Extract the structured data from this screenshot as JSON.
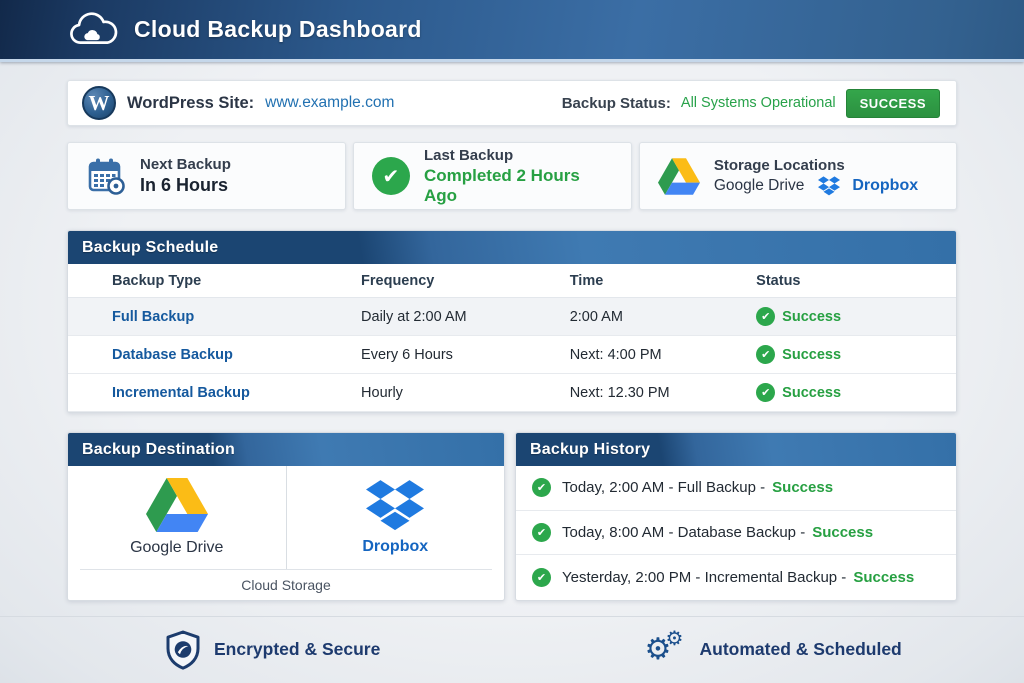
{
  "header": {
    "title": "Cloud Backup Dashboard"
  },
  "site_bar": {
    "label": "WordPress Site:",
    "url": "www.example.com",
    "status_label": "Backup Status:",
    "status_value": "All Systems Operational",
    "badge": "SUCCESS",
    "wp_initial": "W"
  },
  "cards": {
    "next": {
      "title": "Next Backup",
      "value": "In 6 Hours"
    },
    "last": {
      "title": "Last Backup",
      "value": "Completed 2 Hours Ago"
    },
    "storage": {
      "title": "Storage Locations",
      "gdrive": "Google Drive",
      "dropbox": "Dropbox"
    }
  },
  "schedule": {
    "title": "Backup Schedule",
    "columns": [
      "Backup Type",
      "Frequency",
      "Time",
      "Status"
    ],
    "rows": [
      {
        "type": "Full Backup",
        "frequency": "Daily at 2:00 AM",
        "time": "2:00 AM",
        "status": "Success"
      },
      {
        "type": "Database Backup",
        "frequency": "Every 6 Hours",
        "time": "Next: 4:00 PM",
        "status": "Success"
      },
      {
        "type": "Incremental Backup",
        "frequency": "Hourly",
        "time": "Next: 12.30 PM",
        "status": "Success"
      }
    ]
  },
  "destination": {
    "title": "Backup Destination",
    "gdrive": "Google Drive",
    "dropbox": "Dropbox",
    "caption": "Cloud Storage"
  },
  "history": {
    "title": "Backup History",
    "items": [
      {
        "text": "Today, 2:00 AM - Full Backup -",
        "status": "Success"
      },
      {
        "text": "Today, 8:00 AM - Database Backup -",
        "status": "Success"
      },
      {
        "text": "Yesterday, 2:00 PM - Incremental Backup -",
        "status": "Success"
      }
    ]
  },
  "footer": {
    "secure": "Encrypted & Secure",
    "automated": "Automated & Scheduled"
  },
  "colors": {
    "header_navy": "#1b3a63",
    "panel_blue": "#1b4572",
    "accent_blue": "#3b6ea5",
    "link_blue": "#2271b1",
    "type_blue": "#15599e",
    "dropbox_blue": "#1565c0",
    "success_green": "#27a042",
    "badge_green": "#2e9e43",
    "gdrive_green": "#2e9b4f",
    "gdrive_yellow": "#fbbc16",
    "gdrive_blue": "#4285f4"
  }
}
